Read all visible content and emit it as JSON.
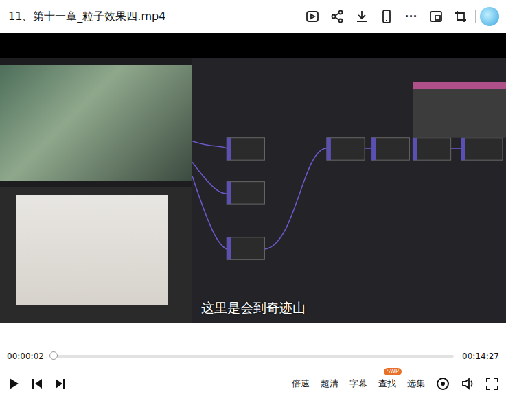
{
  "window": {
    "title": "11、第十一章_粒子效果四.mp4"
  },
  "top_actions": [
    {
      "name": "open-app"
    },
    {
      "name": "share"
    },
    {
      "name": "download"
    },
    {
      "name": "phone"
    },
    {
      "name": "more",
      "label": "···"
    },
    {
      "name": "pip"
    },
    {
      "name": "crop"
    },
    {
      "name": "avatar"
    }
  ],
  "video": {
    "subtitle": "这里是会到奇迹山"
  },
  "progress": {
    "current": "00:00:02",
    "total": "00:14:27",
    "level": 0.003
  },
  "player": {
    "playing": false
  },
  "controls": [
    {
      "label": "倍速",
      "badge": ""
    },
    {
      "label": "超清",
      "badge": ""
    },
    {
      "label": "字幕",
      "badge": ""
    },
    {
      "label": "查找",
      "badge": "SWP"
    },
    {
      "label": "选集",
      "badge": ""
    }
  ]
}
